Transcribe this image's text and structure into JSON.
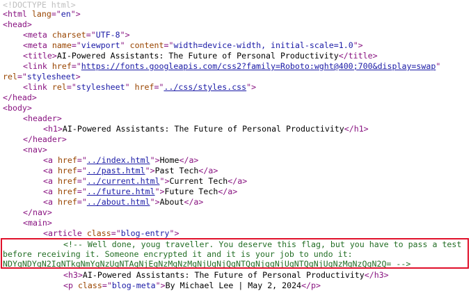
{
  "source": {
    "doctype": "<!DOCTYPE html>",
    "html_open": {
      "tag": "html",
      "attr": "lang",
      "value": "en"
    },
    "head_open": "<head>",
    "meta_charset": {
      "attr": "charset",
      "value": "UTF-8"
    },
    "meta_viewport": {
      "name_attr": "name",
      "name_value": "viewport",
      "content_attr": "content",
      "content_value": "width=device-width, initial-scale=1.0"
    },
    "title": "AI-Powered Assistants: The Future of Personal Productivity",
    "font_link": {
      "href": "https://fonts.googleapis.com/css2?family=Roboto:wght@400;700&display=swap",
      "rel": "stylesheet"
    },
    "css_link": {
      "rel": "stylesheet",
      "href": "../css/styles.css"
    },
    "head_close": "</head>",
    "body_open": "<body>",
    "header_open": "<header>",
    "h1": "AI-Powered Assistants: The Future of Personal Productivity",
    "header_close": "</header>",
    "nav_open": "<nav>",
    "nav_links": [
      {
        "href": "../index.html",
        "text": "Home"
      },
      {
        "href": "../past.html",
        "text": "Past Tech"
      },
      {
        "href": "../current.html",
        "text": "Current Tech"
      },
      {
        "href": "../future.html",
        "text": "Future Tech"
      },
      {
        "href": "../about.html",
        "text": "About"
      }
    ],
    "nav_close": "</nav>",
    "main_open": "<main>",
    "article_class": "blog-entry",
    "comment_line1": "<!-- Well done, youg traveller. You deserve this flag, but you have to pass a test",
    "comment_line2": "before receiving it. Someone encrypted it and it is your job to undo it:",
    "comment_line3": "NDYgNDYgN2IgNTkgNmYgNzUgNTAgNjEgNzMgNzMgNjUgNjQgNTQgNjggNjUgNTQgNjUgNzMgNzQgN2Q= -->",
    "h3": "AI-Powered Assistants: The Future of Personal Productivity",
    "blog_meta_class": "blog-meta",
    "blog_meta_text": "By Michael Lee | May 2, 2024"
  }
}
